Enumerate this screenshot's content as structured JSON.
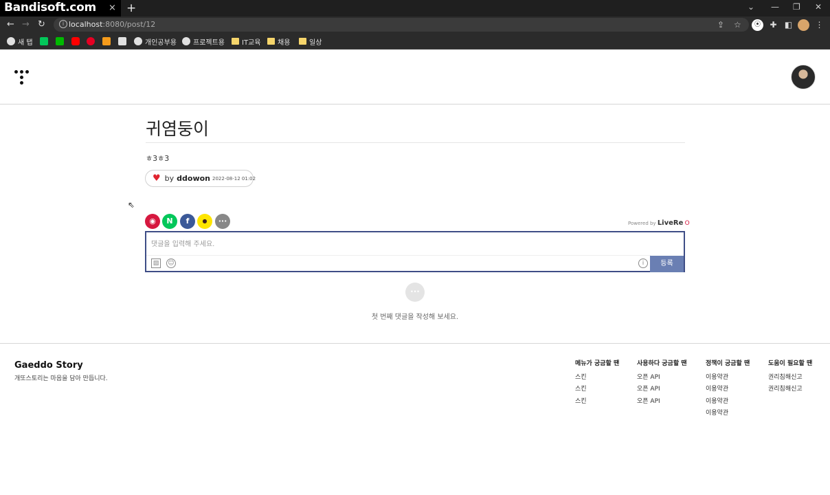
{
  "browser": {
    "tab_title": "Bandisoft.com",
    "tab_close": "×",
    "new_tab": "+",
    "url_host": "localhost",
    "url_path": ":8080/post/12",
    "bookmarks": [
      "새 탭",
      "개인공부용",
      "프로젝트용",
      "IT교육",
      "채용",
      "일상"
    ]
  },
  "post": {
    "title": "귀염둥이",
    "body": "ㅎ3ㅎ3",
    "by_label": "by",
    "author": "ddowon",
    "date": "2022-08-12 01:02"
  },
  "comments": {
    "powered_prefix": "Powered by",
    "powered_brand": "LiveRe",
    "placeholder": "댓글을 입력해 주세요.",
    "submit_label": "등록",
    "empty_message": "첫 번째 댓글을 작성해 보세요."
  },
  "footer": {
    "brand": "Gaeddo Story",
    "tagline": "개또스토리는 마음을 담아 만듭니다.",
    "columns": [
      {
        "heading": "메뉴가 궁금할 땐",
        "links": [
          "스킨",
          "스킨",
          "스킨"
        ]
      },
      {
        "heading": "사용하다 궁금할 땐",
        "links": [
          "오픈 API",
          "오픈 API",
          "오픈 API"
        ]
      },
      {
        "heading": "정책이 궁금할 땐",
        "links": [
          "이용약관",
          "이용약관",
          "이용약관",
          "이용약관"
        ]
      },
      {
        "heading": "도움이 필요할 땐",
        "links": [
          "권리침해신고",
          "권리침해신고"
        ]
      }
    ]
  },
  "colors": {
    "accent": "#3e4d86",
    "submit_bg": "#6a7fb3",
    "heart": "#e0242f"
  }
}
